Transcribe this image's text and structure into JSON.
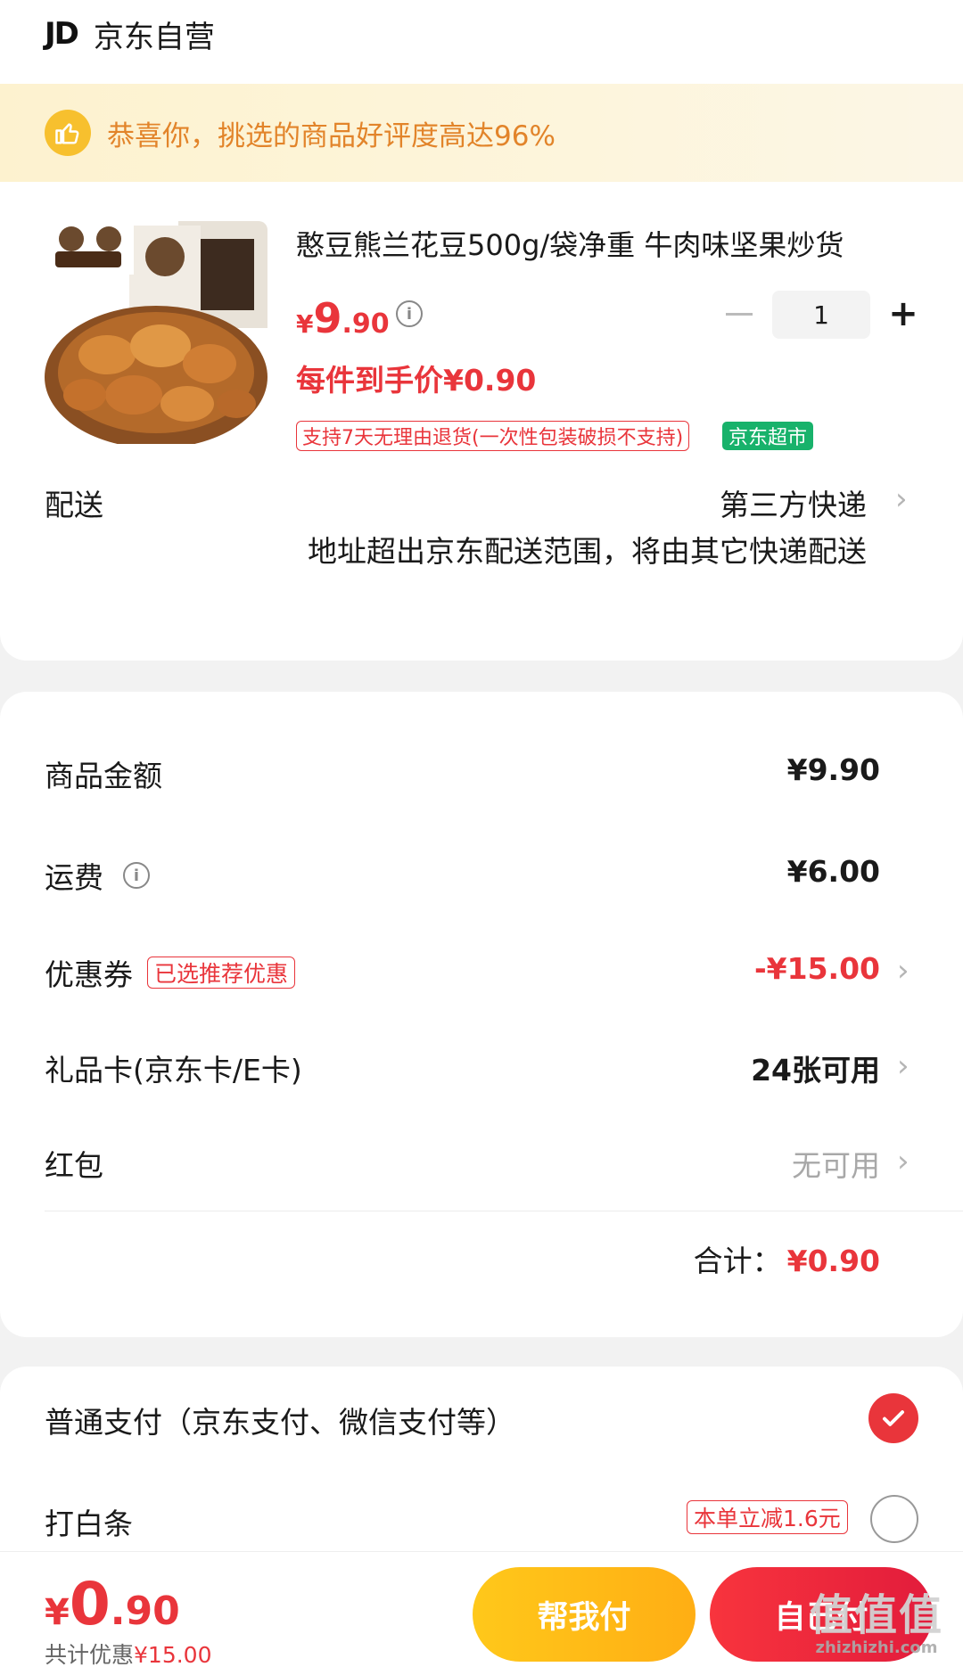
{
  "store": {
    "logo": "JD",
    "name": "京东自营"
  },
  "banner": {
    "text": "恭喜你，挑选的商品好评度高达96%"
  },
  "product": {
    "title": "憨豆熊兰花豆500g/袋净重 牛肉味坚果炒货",
    "price_currency": "¥",
    "price_int": "9",
    "price_dec": ".90",
    "info_glyph": "i",
    "minus_label": "",
    "quantity": "1",
    "plus_label": "+",
    "unit_price": "每件到手价¥0.90",
    "tag_return": "支持7天无理由退货(一次性包装破损不支持)",
    "tag_market": "京东超市"
  },
  "shipping": {
    "label": "配送",
    "method": "第三方快递",
    "note": "地址超出京东配送范围，将由其它快递配送",
    "chevron": "›"
  },
  "amounts": {
    "goods_label": "商品金额",
    "goods_value": "¥9.90",
    "freight_label": "运费",
    "freight_info": "i",
    "freight_value": "¥6.00",
    "coupon_label": "优惠券",
    "coupon_tag": "已选推荐优惠",
    "coupon_value": "-¥15.00",
    "giftcard_label": "礼品卡(京东卡/E卡)",
    "giftcard_value": "24张可用",
    "redpack_label": "红包",
    "redpack_value": "无可用",
    "total_label": "合计：",
    "total_value": "¥0.90",
    "chevron": "›"
  },
  "payment": {
    "normal_label": "普通支付（京东支付、微信支付等）",
    "normal_selected": true,
    "baitiao_label": "打白条",
    "baitiao_tag": "本单立减1.6元",
    "baitiao_selected": false
  },
  "bottom": {
    "price_currency": "¥",
    "price_int": "0",
    "price_dec": ".90",
    "save_label": "共计优惠",
    "save_value": "¥15.00",
    "help_pay_label": "帮我付",
    "self_pay_label": "自己付"
  },
  "watermark": {
    "big": "值值值",
    "small": "zhizhizhi.com"
  },
  "colors": {
    "accent_red": "#e9353b",
    "banner_text": "#e2842a",
    "market_green": "#18b26b",
    "help_button": "#ffb614"
  }
}
